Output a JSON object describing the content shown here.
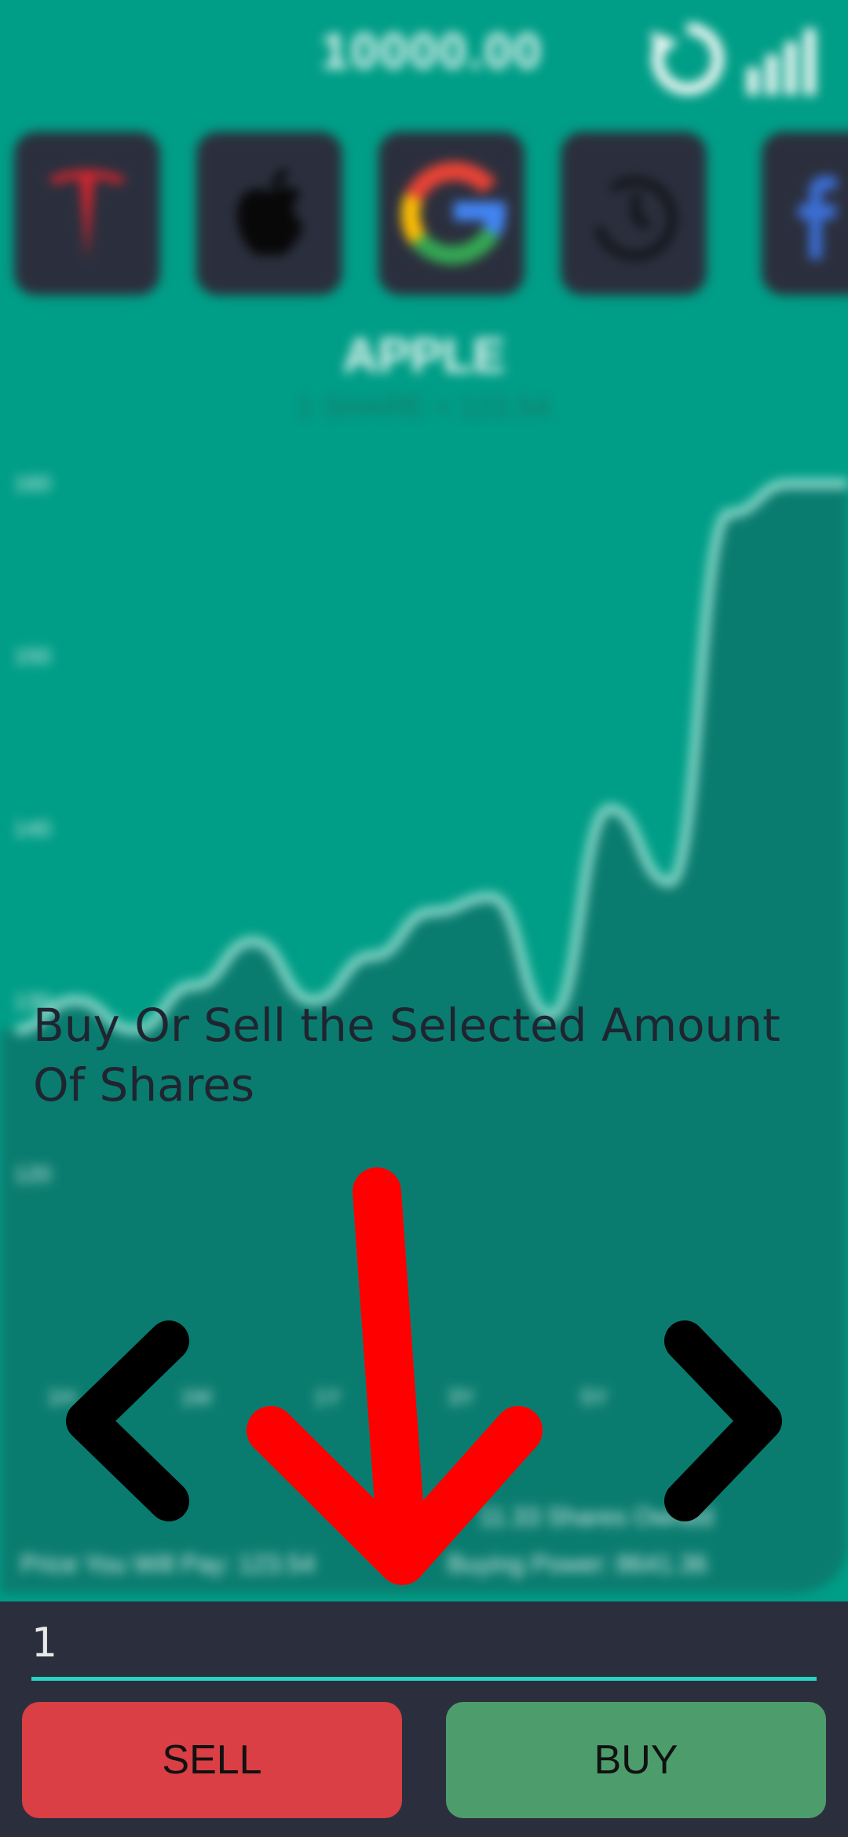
{
  "header": {
    "balance": "10000.00",
    "refresh_icon": "refresh-icon",
    "stats_icon": "bar-chart-icon"
  },
  "stocks": [
    {
      "name": "tesla",
      "icon": "tesla-logo"
    },
    {
      "name": "apple",
      "icon": "apple-logo"
    },
    {
      "name": "google",
      "icon": "google-logo"
    },
    {
      "name": "history",
      "icon": "history-icon"
    },
    {
      "name": "facebook",
      "icon": "facebook-logo"
    }
  ],
  "selected_stock": {
    "name": "APPLE",
    "price_line": "1 SHARE = 123.54"
  },
  "chart_data": {
    "type": "area",
    "y_ticks": [
      "160",
      "150",
      "140",
      "130",
      "120"
    ],
    "x_ticks": [
      "1H",
      "1M",
      "1Y",
      "3Y",
      "5Y"
    ],
    "values": [
      128,
      130,
      128,
      131,
      134,
      130,
      133,
      136,
      137,
      129,
      143,
      138,
      163,
      165,
      165
    ]
  },
  "info": {
    "shares_owned": "11.33 Shares Owned",
    "price_you_pay": "Price You Will Pay: 123.54",
    "buying_power": "Buying Power: 8641.36"
  },
  "tutorial": {
    "text": "Buy Or Sell the Selected Amount\n Of Shares",
    "prev_icon": "chevron-left-icon",
    "next_icon": "chevron-right-icon",
    "pointer_icon": "arrow-down-icon"
  },
  "trade": {
    "amount_value": "1",
    "sell_label": "SELL",
    "buy_label": "BUY"
  },
  "colors": {
    "background": "#009e87",
    "panel": "#2b2f3d",
    "accent": "#27d3c3",
    "sell": "#d93f44",
    "buy": "#4d9d6c",
    "arrow": "#ff0000"
  }
}
